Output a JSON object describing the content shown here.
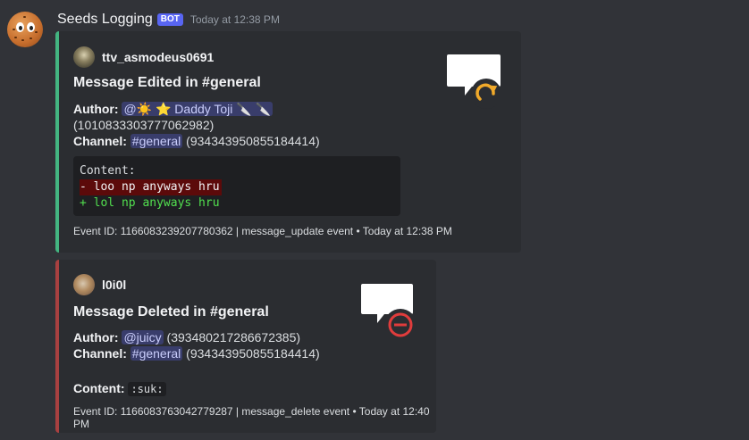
{
  "message": {
    "author": "Seeds Logging",
    "tag": "BOT",
    "timestamp": "Today at 12:38 PM"
  },
  "embed_edit": {
    "author": "ttv_asmodeus0691",
    "title": "Message Edited in #general",
    "author_label": "Author:",
    "author_mention": "@☀️ ⭐ Daddy Toji 🔪 🔪",
    "author_id": "(1010833303777062982)",
    "channel_label": "Channel:",
    "channel_mention": "#general",
    "channel_id": "(934343950855184414)",
    "code_header": "Content:",
    "code_removed": "- loo np anyways hru",
    "code_added": "+ lol np anyways hru",
    "footer": "Event ID: 1166083239207780362 | message_update event • Today at 12:38 PM",
    "accent": "#43b581",
    "icon": "message-edit-icon"
  },
  "embed_delete": {
    "author": "l0i0l",
    "title": "Message Deleted in #general",
    "author_label": "Author:",
    "author_mention": "@juicy",
    "author_id": "(393480217286672385)",
    "channel_label": "Channel:",
    "channel_mention": "#general",
    "channel_id": "(934343950855184414)",
    "content_label": "Content:",
    "content_value": ":suk:",
    "footer": "Event ID: 1166083763042779287 | message_delete event • Today at 12:40 PM",
    "accent": "#a84040",
    "icon": "message-delete-icon"
  }
}
